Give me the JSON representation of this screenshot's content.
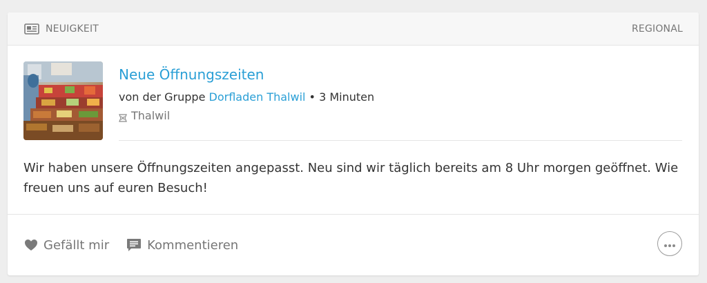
{
  "header": {
    "category_label": "NEUIGKEIT",
    "scope_label": "REGIONAL",
    "category_icon": "newspaper-icon"
  },
  "post": {
    "title": "Neue Öffnungszeiten",
    "meta_prefix": "von der Gruppe",
    "group_name": "Dorfladen Thalwil",
    "meta_separator": "•",
    "time_ago": "3 Minuten",
    "location_icon": "location-marker-icon",
    "location": "Thalwil",
    "body": "Wir haben unsere Öffnungszeiten angepasst. Neu sind wir täglich bereits am 8 Uhr morgen geöffnet. Wie freuen uns auf euren Besuch!"
  },
  "actions": {
    "like_label": "Gefällt mir",
    "comment_label": "Kommentieren",
    "more_icon": "more-dots-icon"
  },
  "colors": {
    "link": "#2a9fd6",
    "muted": "#767676",
    "text": "#333333",
    "header_bg": "#f7f7f7",
    "page_bg": "#eeeeee"
  }
}
